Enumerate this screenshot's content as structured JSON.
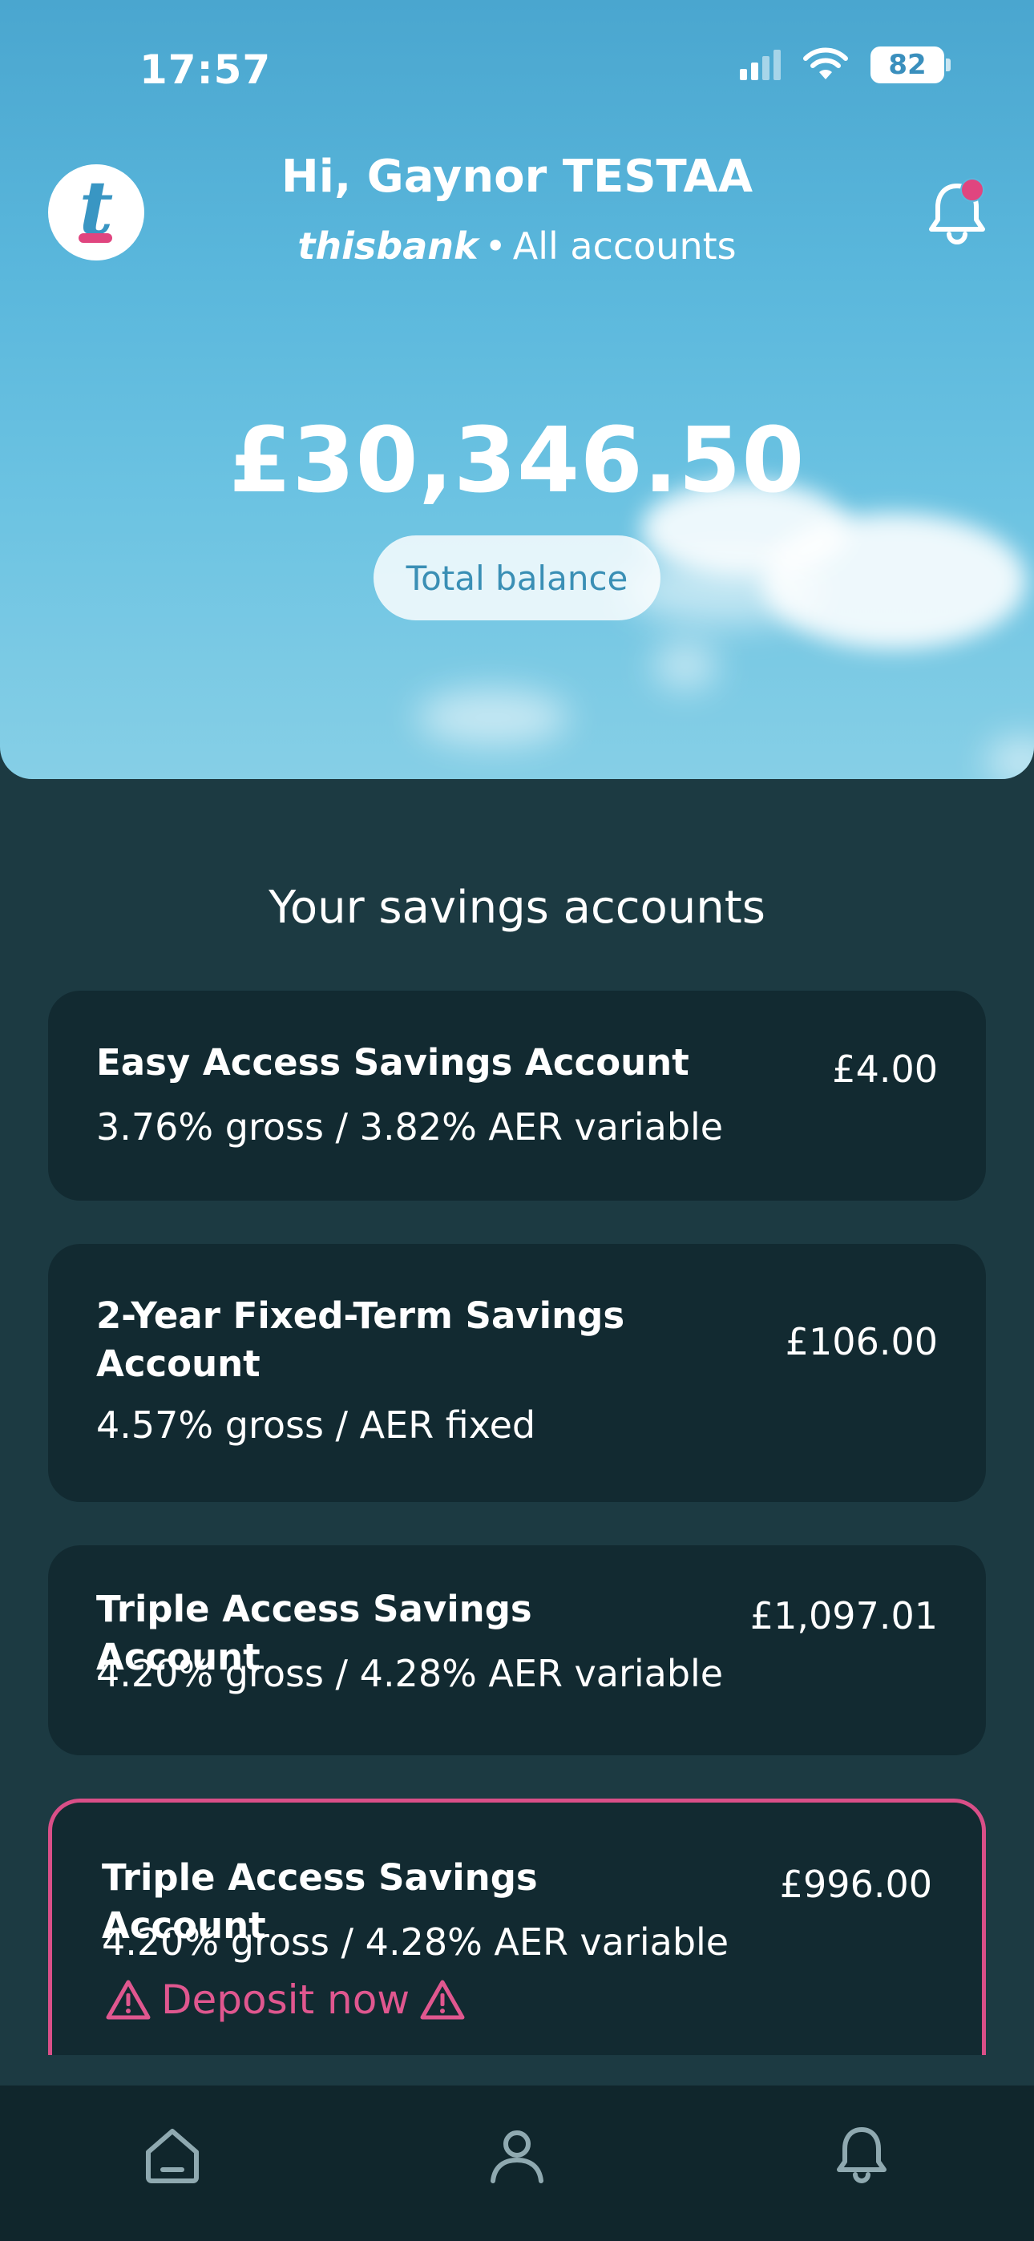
{
  "status_bar": {
    "time": "17:57",
    "battery": "82"
  },
  "header": {
    "greeting": "Hi, Gaynor TESTAA",
    "brand": "thisbank",
    "separator": "•",
    "scope": "All accounts",
    "logo_letter": "t"
  },
  "balance": {
    "amount": "£30,346.50",
    "label": "Total balance"
  },
  "savings": {
    "title": "Your savings accounts",
    "accounts": [
      {
        "name": "Easy Access Savings Account",
        "rate": "3.76% gross / 3.82% AER variable",
        "balance": "£4.00"
      },
      {
        "name": "2-Year Fixed-Term Savings Account",
        "rate": "4.57% gross / AER fixed",
        "balance": "£106.00"
      },
      {
        "name": "Triple Access Savings Account",
        "rate": "4.20% gross / 4.28% AER variable",
        "balance": "£1,097.01"
      },
      {
        "name": "Triple Access Savings Account",
        "rate": "4.20% gross / 4.28% AER variable",
        "balance": "£996.00",
        "action": "Deposit now"
      }
    ]
  },
  "colors": {
    "accent_pink": "#e0457f",
    "sky": "#5ab7dc",
    "card": "#122a31",
    "background": "#1c3a42"
  },
  "icons": {
    "nav": [
      "home-icon",
      "profile-icon",
      "notifications-icon"
    ],
    "header": [
      "bell-icon",
      "warning-icon"
    ]
  }
}
